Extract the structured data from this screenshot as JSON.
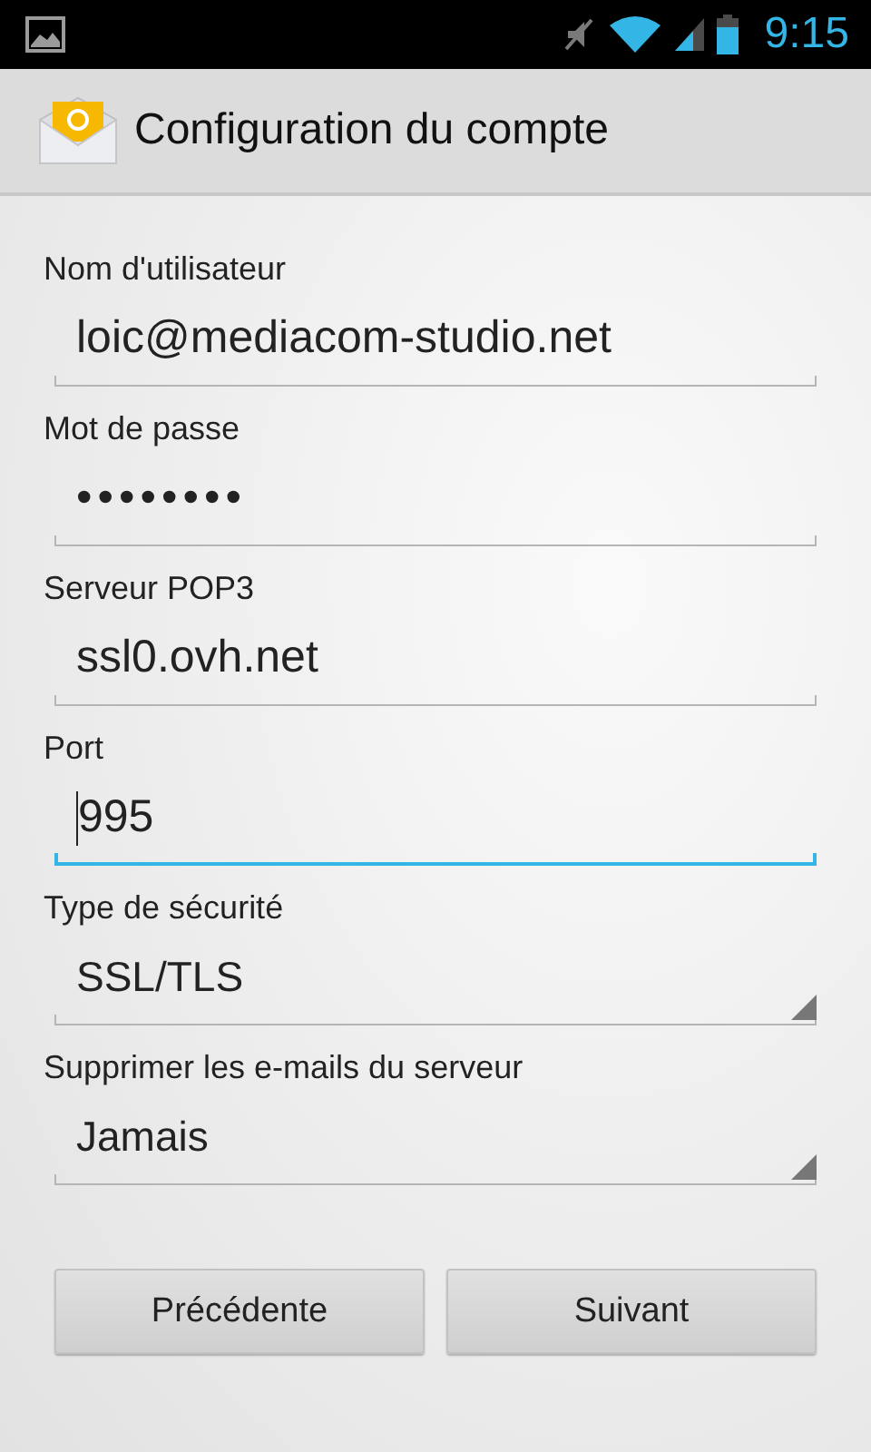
{
  "status_bar": {
    "time": "9:15"
  },
  "action_bar": {
    "title": "Configuration du compte"
  },
  "fields": [
    {
      "label": "Nom d'utilisateur",
      "kind": "text",
      "value": "loic@mediacom-studio.net",
      "focused": false
    },
    {
      "label": "Mot de passe",
      "kind": "password",
      "value": "••••••••",
      "focused": false
    },
    {
      "label": "Serveur POP3",
      "kind": "text",
      "value": "ssl0.ovh.net",
      "focused": false
    },
    {
      "label": "Port",
      "kind": "text",
      "value": "995",
      "focused": true
    },
    {
      "label": "Type de sécurité",
      "kind": "select",
      "value": "SSL/TLS",
      "focused": false
    },
    {
      "label": "Supprimer les e-mails du serveur",
      "kind": "select",
      "value": "Jamais",
      "focused": false
    }
  ],
  "buttons": [
    "Précédente",
    "Suivant"
  ]
}
